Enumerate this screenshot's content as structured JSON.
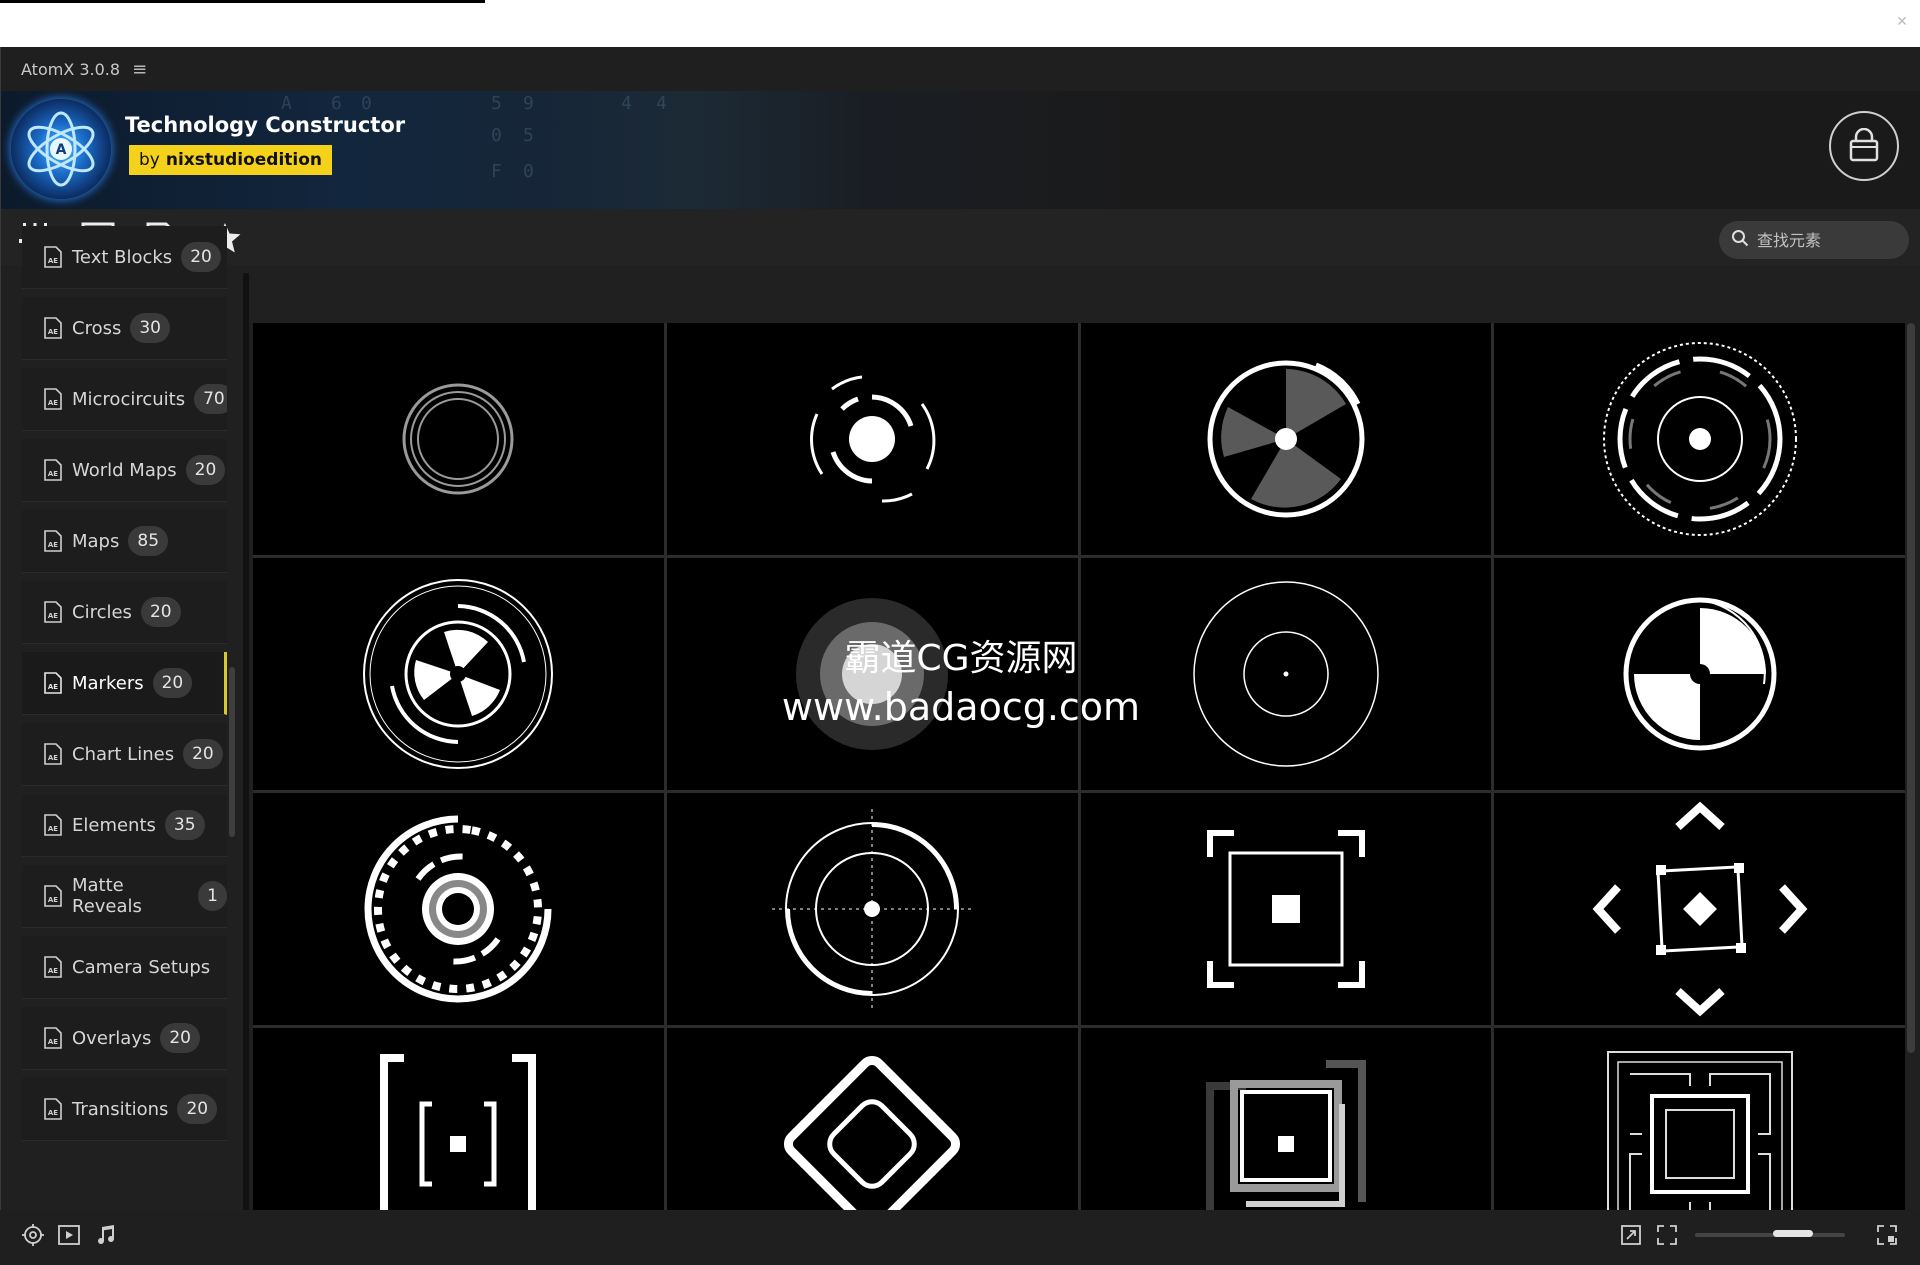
{
  "window": {
    "close_glyph": "✕"
  },
  "app": {
    "title": "AtomX 3.0.8",
    "menu_glyph": "≡"
  },
  "banner": {
    "pack_title": "Technology Constructor",
    "author_prefix": "by",
    "author_name": "nixstudioedition",
    "accent_color": "#f4d21b",
    "code_glyphs": [
      "5",
      "9",
      "4",
      "4",
      "0",
      "5",
      "F",
      "0",
      "6",
      "0",
      "A"
    ]
  },
  "toolbar": {
    "icons": [
      "sliders-icon",
      "list-icon",
      "media-file-icon",
      "favorites-star-icon"
    ],
    "search_placeholder": "查找元素"
  },
  "sidebar": {
    "categories": [
      {
        "label": "Text Blocks",
        "count": "20",
        "active": false
      },
      {
        "label": "Cross",
        "count": "30",
        "active": false
      },
      {
        "label": "Microcircuits",
        "count": "70",
        "active": false
      },
      {
        "label": "World Maps",
        "count": "20",
        "active": false
      },
      {
        "label": "Maps",
        "count": "85",
        "active": false
      },
      {
        "label": "Circles",
        "count": "20",
        "active": false
      },
      {
        "label": "Markers",
        "count": "20",
        "active": true
      },
      {
        "label": "Chart Lines",
        "count": "20",
        "active": false
      },
      {
        "label": "Elements",
        "count": "35",
        "active": false
      },
      {
        "label": "Matte Reveals",
        "count": "1",
        "active": false
      },
      {
        "label": "Camera Setups",
        "count": "",
        "active": false
      },
      {
        "label": "Overlays",
        "count": "20",
        "active": false
      },
      {
        "label": "Transitions",
        "count": "20",
        "active": false
      }
    ]
  },
  "grid": {
    "items": [
      "marker-concentric-rings",
      "marker-arc-pulse",
      "marker-pie-disc",
      "marker-segmented-ring",
      "marker-fan-target",
      "marker-glow-dot",
      "marker-thin-ring",
      "marker-quadrant-disc",
      "marker-dashed-orbit",
      "marker-crosshair-ring",
      "marker-square-frame",
      "marker-arrow-square",
      "marker-bracket-square",
      "marker-diamond",
      "marker-offset-squares",
      "marker-maze-square"
    ]
  },
  "watermark": {
    "line1": "霸道CG资源网",
    "line2": "www.badaocg.com"
  },
  "bottombar": {
    "left_icons": [
      "target-gear-icon",
      "play-icon",
      "music-note-icon"
    ],
    "right_icons": [
      "expand-icon",
      "fullscreen-icon",
      "layout-icon"
    ],
    "zoom_level": 0.6
  }
}
